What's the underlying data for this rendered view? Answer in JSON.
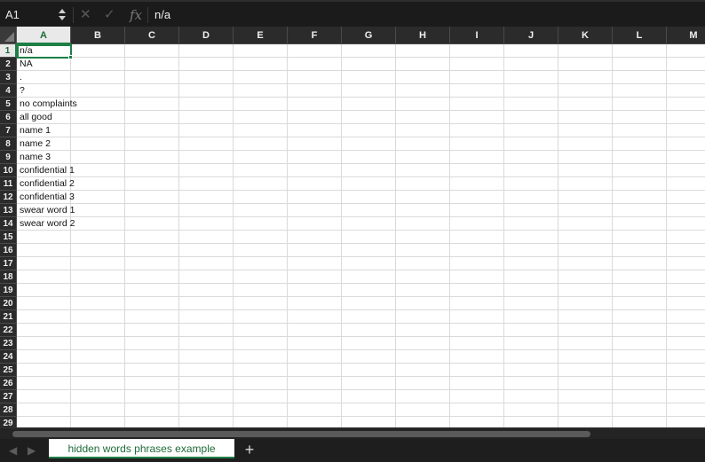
{
  "formula_bar": {
    "name_box": "A1",
    "cancel_icon": "x-icon",
    "enter_icon": "check-icon",
    "fx_label": "fx",
    "formula_value": "n/a"
  },
  "columns": [
    "A",
    "B",
    "C",
    "D",
    "E",
    "F",
    "G",
    "H",
    "I",
    "J",
    "K",
    "L",
    "M"
  ],
  "rows": [
    "1",
    "2",
    "3",
    "4",
    "5",
    "6",
    "7",
    "8",
    "9",
    "10",
    "11",
    "12",
    "13",
    "14",
    "15",
    "16",
    "17",
    "18",
    "19",
    "20",
    "21",
    "22",
    "23",
    "24",
    "25",
    "26",
    "27",
    "28",
    "29"
  ],
  "column_a_values": [
    "n/a",
    "NA",
    ".",
    "?",
    "no complaints",
    "all good",
    "name 1",
    "name 2",
    "name 3",
    "confidential 1",
    "confidential 2",
    "confidential 3",
    "swear word 1",
    "swear word 2"
  ],
  "selection": {
    "active_cell": "A1",
    "column": "A",
    "row": "1"
  },
  "sheet_tabs": [
    {
      "label": "hidden words phrases example",
      "active": true
    }
  ],
  "tab_bar": {
    "prev_icon": "chevron-left-icon",
    "next_icon": "chevron-right-icon",
    "add_sheet_label": "+"
  },
  "colors": {
    "accent": "#1e7f46",
    "header_bg": "#2b2b2b",
    "gridline": "#dadada"
  }
}
